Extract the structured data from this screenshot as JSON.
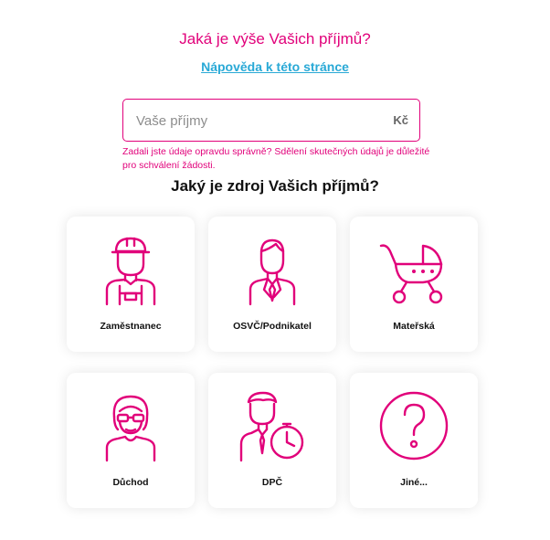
{
  "title": "Jaká je výše Vašich příjmů?",
  "help_link": "Nápověda k této stránce",
  "income": {
    "placeholder": "Vaše příjmy",
    "value": "",
    "currency": "Kč"
  },
  "warning": "Zadali jste údaje opravdu správně? Sdělení skutečných údajů je důležité pro schválení žádosti.",
  "subtitle": "Jaký je zdroj Vašich příjmů?",
  "sources": [
    {
      "label": "Zaměstnanec",
      "icon": "worker-icon"
    },
    {
      "label": "OSVČ/Podnikatel",
      "icon": "businessman-icon"
    },
    {
      "label": "Mateřská",
      "icon": "baby-stroller-icon"
    },
    {
      "label": "Důchod",
      "icon": "elderly-woman-icon"
    },
    {
      "label": "DPČ",
      "icon": "man-with-stopwatch-icon"
    },
    {
      "label": "Jiné...",
      "icon": "question-mark-icon"
    }
  ],
  "colors": {
    "accent": "#e1007a",
    "link": "#29a9d6"
  }
}
